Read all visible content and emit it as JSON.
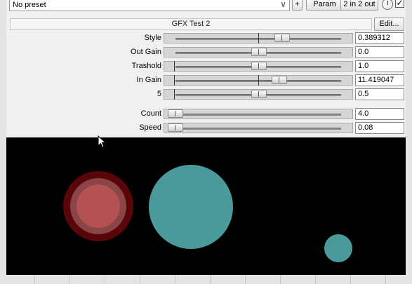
{
  "toolbar": {
    "preset": "No preset",
    "plus_label": "+",
    "param_label": "Param",
    "io_label": "2 in 2 out"
  },
  "plugin": {
    "title": "GFX Test 2",
    "edit_label": "Edit..."
  },
  "sliders": [
    {
      "label": "Style",
      "value": "0.389312",
      "position": 0.64,
      "center_line": true
    },
    {
      "label": "Out Gain",
      "value": "0.0",
      "position": 0.5,
      "center_line": false
    },
    {
      "label": "Trashold",
      "value": "1.0",
      "position": 0.5,
      "center_line": false
    },
    {
      "label": "In Gain",
      "value": "11.419047",
      "position": 0.62,
      "center_line": true
    },
    {
      "label": "5",
      "value": "0.5",
      "position": 0.5,
      "center_line": false
    },
    {
      "label": "Count",
      "value": "4.0",
      "position": 0.0,
      "center_line": false
    },
    {
      "label": "Speed",
      "value": "0.08",
      "position": 0.0,
      "center_line": false
    }
  ],
  "colors": {
    "gfx_background": "#000000",
    "teal_circle": "#4a9a9c",
    "red_outer": "#5a0608",
    "red_mid": "#8a4547",
    "red_inner": "#b35153"
  }
}
